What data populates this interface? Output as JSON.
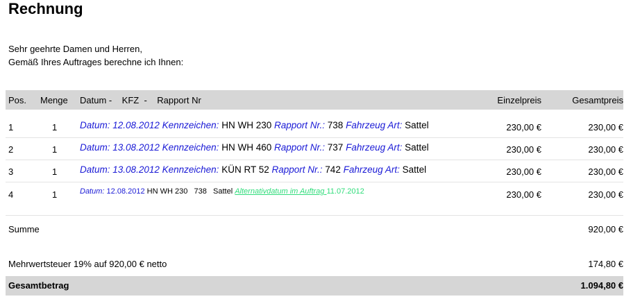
{
  "title": "Rechnung",
  "greeting": [
    "Sehr geehrte Damen und Herren,",
    "Gemäß Ihres Auftrages berechne ich Ihnen:"
  ],
  "headers": {
    "pos": "Pos.",
    "menge": "Menge",
    "desc": "Datum -    KFZ  -    Rapport Nr",
    "einzelpreis": "Einzelpreis",
    "gesamtpreis": "Gesamtpreis"
  },
  "rows": [
    {
      "pos": "1",
      "menge": "1",
      "datum_label": "Datum:",
      "datum": "12.08.2012",
      "kz_label": "Kennzeichen:",
      "kz": "HN WH 230",
      "rap_label": "Rapport Nr.:",
      "rap": "738",
      "art_label": "Fahrzeug Art:",
      "art": "Sattel",
      "einzelpreis": "230,00 €",
      "gesamtpreis": "230,00 €"
    },
    {
      "pos": "2",
      "menge": "1",
      "datum_label": "Datum:",
      "datum": "13.08.2012",
      "kz_label": "Kennzeichen:",
      "kz": "HN WH 460",
      "rap_label": "Rapport Nr.:",
      "rap": "737",
      "art_label": "Fahrzeug Art:",
      "art": "Sattel",
      "einzelpreis": "230,00 €",
      "gesamtpreis": "230,00 €"
    },
    {
      "pos": "3",
      "menge": "1",
      "datum_label": "Datum:",
      "datum": "13.08.2012",
      "kz_label": "Kennzeichen:",
      "kz": "KÜN RT 52",
      "rap_label": "Rapport Nr.:",
      "rap": "742",
      "art_label": "Fahrzeug Art:",
      "art": "Sattel",
      "einzelpreis": "230,00 €",
      "gesamtpreis": "230,00 €"
    },
    {
      "pos": "4",
      "menge": "1",
      "datum_label": "Datum:",
      "datum": "12.08.2012",
      "details": "HN WH 230   738   Sattel",
      "alt_label": "Alternativdatum im Auftrag ",
      "alt_date": "11.07.2012",
      "einzelpreis": "230,00 €",
      "gesamtpreis": "230,00 €"
    }
  ],
  "summe_label": "Summe",
  "summe_value": "920,00 €",
  "mwst_label": "Mehrwertsteuer 19% auf 920,00 € netto",
  "mwst_value": "174,80 €",
  "gesamt_label": "Gesamtbetrag",
  "gesamt_value": "1.094,80 €",
  "colors": {
    "label_blue": "#1a1ad6",
    "alt_green": "#2fdc7a",
    "bar_gray": "#d6d6d6"
  }
}
